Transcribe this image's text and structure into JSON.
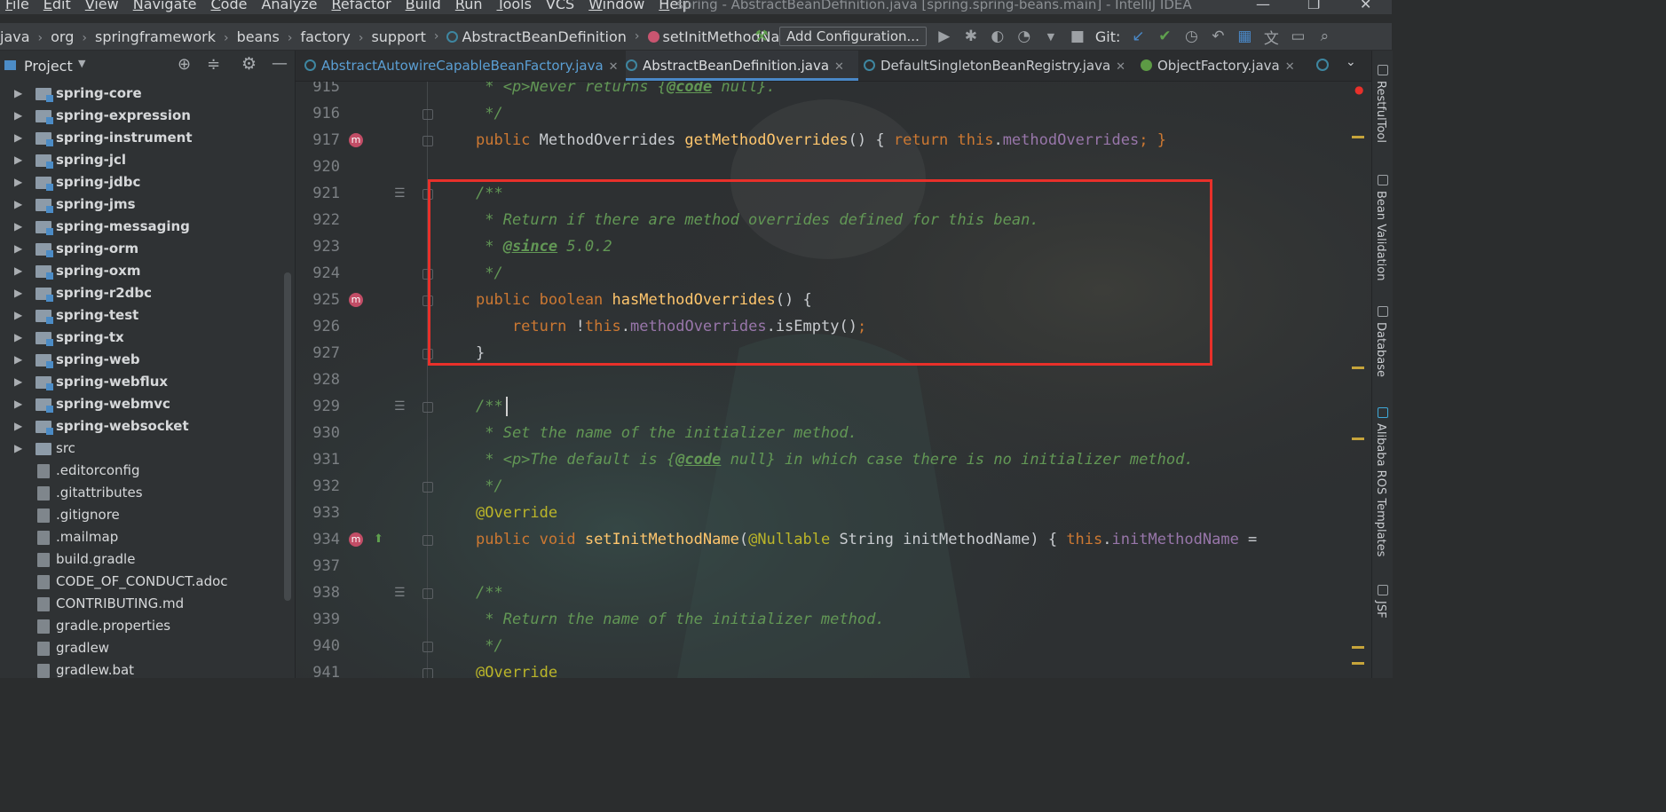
{
  "menu": {
    "items": [
      {
        "mnemonic": "F",
        "rest": "ile"
      },
      {
        "mnemonic": "E",
        "rest": "dit"
      },
      {
        "mnemonic": "V",
        "rest": "iew"
      },
      {
        "mnemonic": "N",
        "rest": "avigate"
      },
      {
        "mnemonic": "C",
        "rest": "ode"
      },
      {
        "mnemonic": "",
        "rest": "Analyze"
      },
      {
        "mnemonic": "R",
        "rest": "efactor"
      },
      {
        "mnemonic": "B",
        "rest": "uild"
      },
      {
        "mnemonic": "R",
        "rest": "un"
      },
      {
        "mnemonic": "T",
        "rest": "ools"
      },
      {
        "mnemonic": "",
        "rest": "VCS"
      },
      {
        "mnemonic": "W",
        "rest": "indow"
      },
      {
        "mnemonic": "H",
        "rest": "elp"
      }
    ],
    "window_title": "spring - AbstractBeanDefinition.java [spring.spring-beans.main] - IntelliJ IDEA"
  },
  "navbar": {
    "breadcrumbs": [
      "java",
      "org",
      "springframework",
      "beans",
      "factory",
      "support"
    ],
    "class_crumb": "AbstractBeanDefinition",
    "method_crumb": "setInitMethodName",
    "run_config": "Add Configuration...",
    "git_label": "Git:"
  },
  "project": {
    "title": "Project",
    "items": [
      {
        "label": "spring-core",
        "kind": "module"
      },
      {
        "label": "spring-expression",
        "kind": "module"
      },
      {
        "label": "spring-instrument",
        "kind": "module"
      },
      {
        "label": "spring-jcl",
        "kind": "module"
      },
      {
        "label": "spring-jdbc",
        "kind": "module"
      },
      {
        "label": "spring-jms",
        "kind": "module"
      },
      {
        "label": "spring-messaging",
        "kind": "module"
      },
      {
        "label": "spring-orm",
        "kind": "module"
      },
      {
        "label": "spring-oxm",
        "kind": "module"
      },
      {
        "label": "spring-r2dbc",
        "kind": "module"
      },
      {
        "label": "spring-test",
        "kind": "module"
      },
      {
        "label": "spring-tx",
        "kind": "module"
      },
      {
        "label": "spring-web",
        "kind": "module"
      },
      {
        "label": "spring-webflux",
        "kind": "module"
      },
      {
        "label": "spring-webmvc",
        "kind": "module"
      },
      {
        "label": "spring-websocket",
        "kind": "module"
      },
      {
        "label": "src",
        "kind": "folder"
      },
      {
        "label": ".editorconfig",
        "kind": "file"
      },
      {
        "label": ".gitattributes",
        "kind": "file"
      },
      {
        "label": ".gitignore",
        "kind": "file"
      },
      {
        "label": ".mailmap",
        "kind": "file"
      },
      {
        "label": "build.gradle",
        "kind": "file"
      },
      {
        "label": "CODE_OF_CONDUCT.adoc",
        "kind": "file"
      },
      {
        "label": "CONTRIBUTING.md",
        "kind": "file"
      },
      {
        "label": "gradle.properties",
        "kind": "file"
      },
      {
        "label": "gradlew",
        "kind": "file"
      },
      {
        "label": "gradlew.bat",
        "kind": "file"
      }
    ]
  },
  "tabs": [
    {
      "label": "AbstractAutowireCapableBeanFactory.java",
      "icon": "class-icon",
      "active": false
    },
    {
      "label": "AbstractBeanDefinition.java",
      "icon": "class-icon",
      "active": true
    },
    {
      "label": "DefaultSingletonBeanRegistry.java",
      "icon": "class-icon",
      "active": false
    },
    {
      "label": "ObjectFactory.java",
      "icon": "interface-icon",
      "active": false
    }
  ],
  "editor": {
    "lines": [
      {
        "n": "915",
        "tokens": [
          [
            " * <p>Never returns {",
            "doc"
          ],
          [
            "@code",
            "doctag"
          ],
          [
            " null}.",
            "doc"
          ]
        ]
      },
      {
        "n": "916",
        "tokens": [
          [
            " */",
            "doc"
          ]
        ]
      },
      {
        "n": "917",
        "tokens": [
          [
            "public ",
            "kw"
          ],
          [
            "MethodOverrides ",
            "plain"
          ],
          [
            "getMethodOverrides",
            "fn"
          ],
          [
            "() { ",
            "plain"
          ],
          [
            "return this",
            "kw"
          ],
          [
            ".",
            "plain"
          ],
          [
            "methodOverrides",
            "fld"
          ],
          [
            "; }",
            "kw"
          ]
        ]
      },
      {
        "n": "920",
        "tokens": []
      },
      {
        "n": "921",
        "tokens": [
          [
            "/**",
            "doc"
          ]
        ]
      },
      {
        "n": "922",
        "tokens": [
          [
            " * Return if there are method overrides defined for this bean.",
            "doc"
          ]
        ]
      },
      {
        "n": "923",
        "tokens": [
          [
            " * ",
            "doc"
          ],
          [
            "@since",
            "doctag"
          ],
          [
            " 5.0.2",
            "doc"
          ]
        ]
      },
      {
        "n": "924",
        "tokens": [
          [
            " */",
            "doc"
          ]
        ]
      },
      {
        "n": "925",
        "tokens": [
          [
            "public boolean ",
            "kw"
          ],
          [
            "hasMethodOverrides",
            "fn"
          ],
          [
            "() {",
            "plain"
          ]
        ]
      },
      {
        "n": "926",
        "tokens": [
          [
            "    return ",
            "kw"
          ],
          [
            "!",
            "plain"
          ],
          [
            "this",
            "kw"
          ],
          [
            ".",
            "plain"
          ],
          [
            "methodOverrides",
            "fld"
          ],
          [
            ".isEmpty()",
            "plain"
          ],
          [
            ";",
            "kw"
          ]
        ]
      },
      {
        "n": "927",
        "tokens": [
          [
            "}",
            "plain"
          ]
        ]
      },
      {
        "n": "928",
        "tokens": []
      },
      {
        "n": "929",
        "tokens": [
          [
            "/**",
            "doc"
          ]
        ]
      },
      {
        "n": "930",
        "tokens": [
          [
            " * Set the name of the initializer method.",
            "doc"
          ]
        ]
      },
      {
        "n": "931",
        "tokens": [
          [
            " * <p>The default is {",
            "doc"
          ],
          [
            "@code",
            "doctag"
          ],
          [
            " null} in which case there is no initializer method.",
            "doc"
          ]
        ]
      },
      {
        "n": "932",
        "tokens": [
          [
            " */",
            "doc"
          ]
        ]
      },
      {
        "n": "933",
        "tokens": [
          [
            "@Override",
            "ann"
          ]
        ]
      },
      {
        "n": "934",
        "tokens": [
          [
            "public void ",
            "kw"
          ],
          [
            "setInitMethodName",
            "fn"
          ],
          [
            "(",
            "plain"
          ],
          [
            "@Nullable ",
            "ann"
          ],
          [
            "String initMethodName) { ",
            "plain"
          ],
          [
            "this",
            "kw"
          ],
          [
            ".",
            "plain"
          ],
          [
            "initMethodName",
            "fld"
          ],
          [
            " =",
            "plain"
          ]
        ]
      },
      {
        "n": "937",
        "tokens": []
      },
      {
        "n": "938",
        "tokens": [
          [
            "/**",
            "doc"
          ]
        ]
      },
      {
        "n": "939",
        "tokens": [
          [
            " * Return the name of the initializer method.",
            "doc"
          ]
        ]
      },
      {
        "n": "940",
        "tokens": [
          [
            " */",
            "doc"
          ]
        ]
      },
      {
        "n": "941",
        "tokens": [
          [
            "@Override",
            "ann"
          ]
        ]
      }
    ]
  },
  "right_strip": {
    "tool_windows": [
      "RestfulTool",
      "Bean Validation",
      "Database",
      "Alibaba ROS Templates",
      "JSF"
    ]
  },
  "colors": {
    "accent": "#4a88c7",
    "highlight_box": "#e8302a",
    "keyword": "#cc7832",
    "method": "#ffc66d",
    "field": "#9876aa",
    "doc_comment": "#629755"
  }
}
